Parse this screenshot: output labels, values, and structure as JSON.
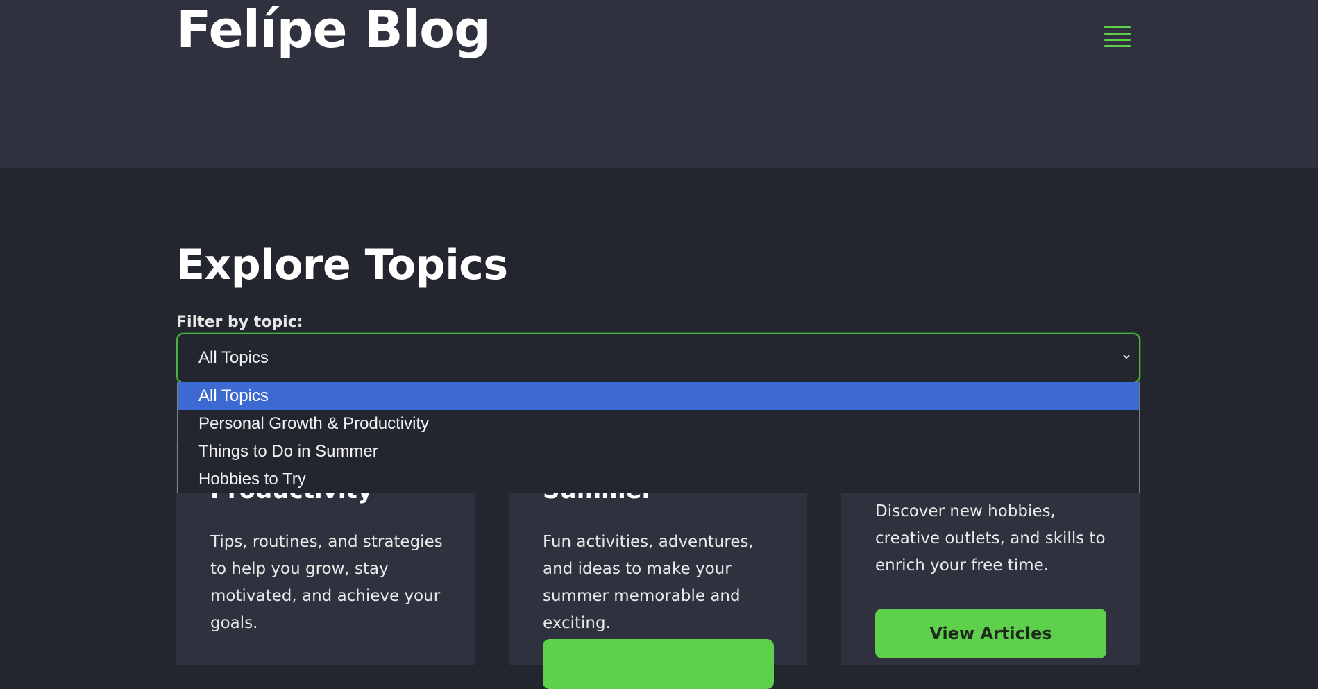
{
  "header": {
    "site_title": "Felípe Blog",
    "menu_icon": "hamburger-menu-icon"
  },
  "main": {
    "section_title": "Explore Topics",
    "filter": {
      "label": "Filter by topic:",
      "selected_value": "All Topics",
      "options": [
        "All Topics",
        "Personal Growth & Productivity",
        "Things to Do in Summer",
        "Hobbies to Try"
      ]
    },
    "cards": [
      {
        "title": "Productivity",
        "description": "Tips, routines, and strategies to help you grow, stay motivated, and achieve your goals."
      },
      {
        "title": "Summer",
        "description": "Fun activities, adventures, and ideas to make your summer memorable and exciting."
      },
      {
        "title": "",
        "description": "Discover new hobbies, creative outlets, and skills to enrich your free time.",
        "button_label": "View Articles"
      }
    ]
  },
  "colors": {
    "accent": "#5dd04c",
    "header_bg": "#2f323e",
    "page_bg": "#23262f",
    "option_highlight": "#3d69d2"
  }
}
